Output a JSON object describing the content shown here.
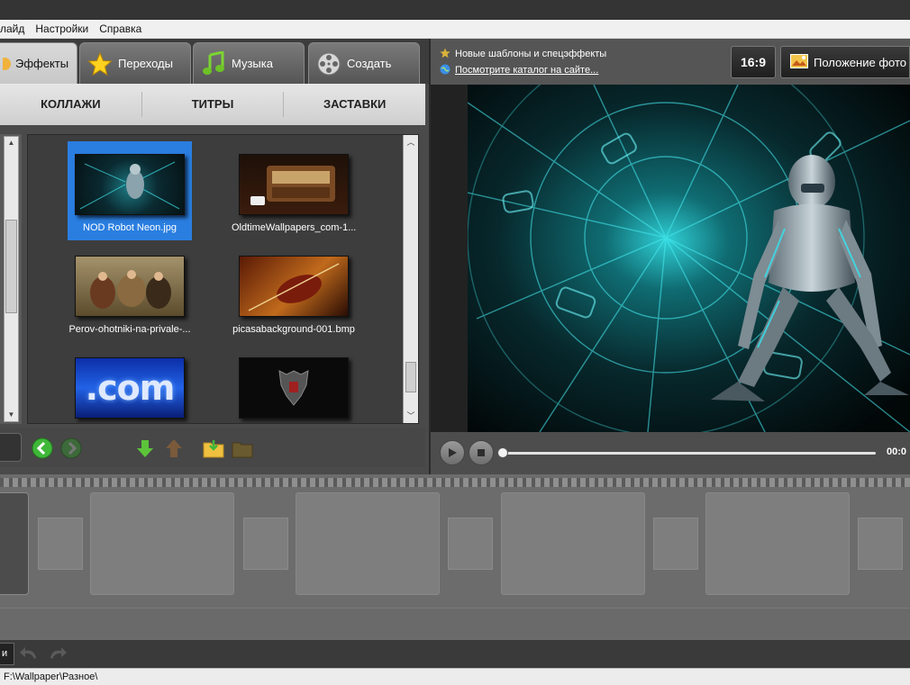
{
  "menu": {
    "items": [
      "лайд",
      "Настройки",
      "Справка"
    ]
  },
  "tabs": [
    {
      "label": "Эффекты",
      "icon": "effects-icon"
    },
    {
      "label": "Переходы",
      "icon": "star-icon"
    },
    {
      "label": "Музыка",
      "icon": "music-note-icon"
    },
    {
      "label": "Создать",
      "icon": "film-reel-icon"
    }
  ],
  "subtabs": [
    "КОЛЛАЖИ",
    "ТИТРЫ",
    "ЗАСТАВКИ"
  ],
  "gallery": {
    "items": [
      {
        "caption": "NOD Robot Neon.jpg",
        "selected": true
      },
      {
        "caption": "OldtimeWallpapers_com-1..."
      },
      {
        "caption": "Perov-ohotniki-na-privale-..."
      },
      {
        "caption": "picasabackground-001.bmp"
      },
      {
        "caption": ""
      },
      {
        "caption": ""
      }
    ],
    "dotcom_text": ".com"
  },
  "info": {
    "new_templates": "Новые шаблоны и спецэффекты",
    "catalog_link": "Посмотрите каталог на сайте..."
  },
  "preview_toolbar": {
    "aspect_ratio": "16:9",
    "photo_position": "Положение фото"
  },
  "player": {
    "time": "00:0"
  },
  "bottom": {
    "truncated_label": "и"
  },
  "status": {
    "path": "F:\\Wallpaper\\Разное\\"
  }
}
